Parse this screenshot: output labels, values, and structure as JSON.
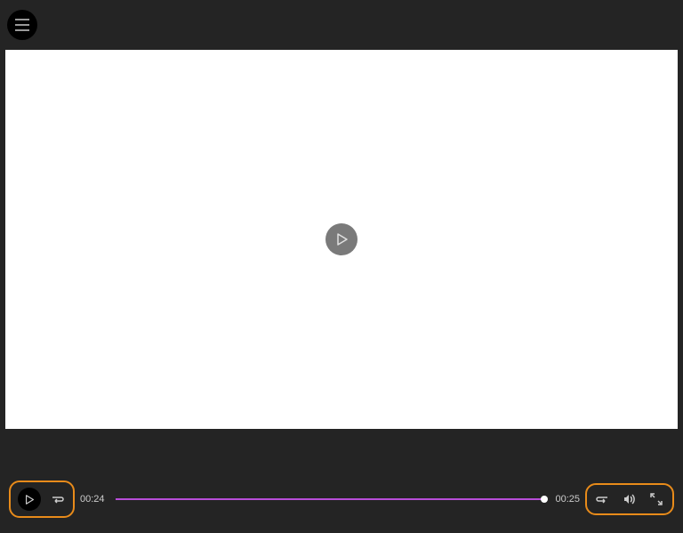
{
  "player": {
    "currentTime": "00:24",
    "duration": "00:25",
    "progressPercent": 96
  },
  "icons": {
    "hamburger": "hamburger",
    "play": "play",
    "skipBack": "skip-back",
    "skipForward": "skip-forward",
    "volume": "volume",
    "fullscreen": "fullscreen"
  }
}
